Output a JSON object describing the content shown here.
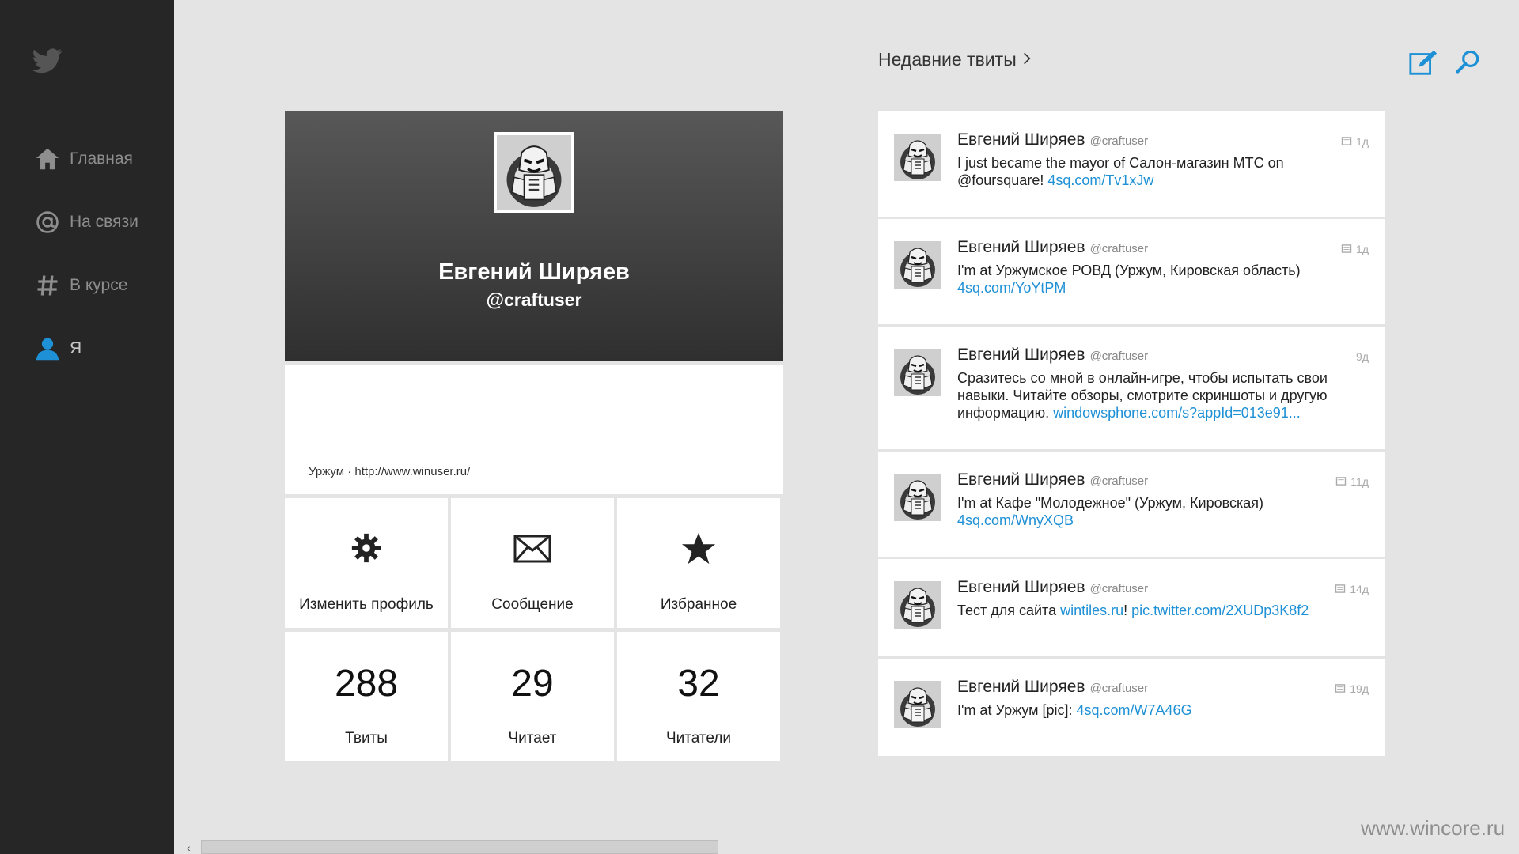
{
  "sidebar": {
    "logo_icon": "twitter-bird-icon",
    "items": [
      {
        "label": "Главная",
        "icon": "home-icon"
      },
      {
        "label": "На связи",
        "icon": "at-icon"
      },
      {
        "label": "В курсе",
        "icon": "hash-icon"
      },
      {
        "label": "Я",
        "icon": "user-icon",
        "active": true
      }
    ]
  },
  "header": {
    "section_title": "Недавние твиты",
    "compose_icon": "compose-icon",
    "search_icon": "search-icon"
  },
  "profile": {
    "name": "Евгений Ширяев",
    "handle": "@craftuser",
    "location_url": "Уржум · http://www.winuser.ru/",
    "actions": [
      {
        "label": "Изменить профиль",
        "icon": "gear-icon"
      },
      {
        "label": "Сообщение",
        "icon": "envelope-icon"
      },
      {
        "label": "Избранное",
        "icon": "star-icon"
      }
    ],
    "stats": [
      {
        "value": "288",
        "label": "Твиты"
      },
      {
        "value": "29",
        "label": "Читает"
      },
      {
        "value": "32",
        "label": "Читатели"
      }
    ]
  },
  "tweets": [
    {
      "name": "Евгений Ширяев",
      "handle": "@craftuser",
      "time": "1д",
      "has_image": true,
      "text": "I just became the mayor of Салон-магазин МТС on @foursquare! ",
      "link": "4sq.com/Tv1xJw",
      "link2": "",
      "between": ""
    },
    {
      "name": "Евгений Ширяев",
      "handle": "@craftuser",
      "time": "1д",
      "has_image": true,
      "text": "I'm at Уржумское РОВД (Уржум, Кировская область) ",
      "link": "4sq.com/YoYtPM",
      "link2": "",
      "between": ""
    },
    {
      "name": "Евгений Ширяев",
      "handle": "@craftuser",
      "time": "9д",
      "has_image": false,
      "text": "Сразитесь со мной в онлайн-игре, чтобы испытать свои навыки. Читайте обзоры, смотрите скриншоты и другую информацию. ",
      "link": "windowsphone.com/s?appId=013e91...",
      "link2": "",
      "between": ""
    },
    {
      "name": "Евгений Ширяев",
      "handle": "@craftuser",
      "time": "11д",
      "has_image": true,
      "text": "I'm at Кафе \"Молодежное\" (Уржум, Кировская) ",
      "link": "4sq.com/WnyXQB",
      "link2": "",
      "between": ""
    },
    {
      "name": "Евгений Ширяев",
      "handle": "@craftuser",
      "time": "14д",
      "has_image": true,
      "text": "Тест для сайта ",
      "link": "wintiles.ru",
      "between": "! ",
      "link2": "pic.twitter.com/2XUDp3K8f2"
    },
    {
      "name": "Евгений Ширяев",
      "handle": "@craftuser",
      "time": "19д",
      "has_image": true,
      "text": "I'm at Уржум [pic]: ",
      "link": "4sq.com/W7A46G",
      "link2": "",
      "between": ""
    }
  ],
  "watermark": "www.wincore.ru",
  "colors": {
    "accent": "#1e90d6",
    "sidebar": "#262626",
    "background": "#e4e4e4"
  }
}
